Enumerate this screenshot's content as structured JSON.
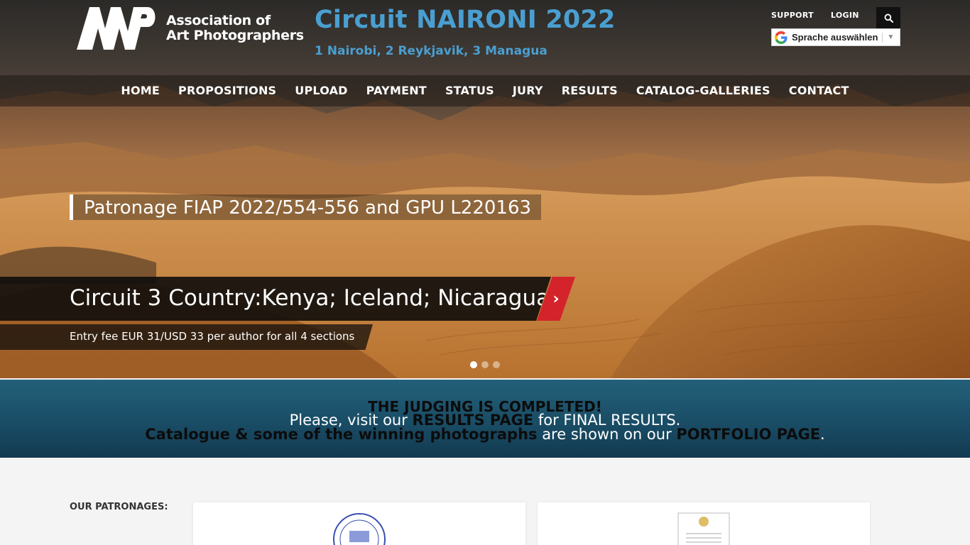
{
  "header": {
    "logo_text_line1": "Association of",
    "logo_text_line2": "Art Photographers",
    "site_title": "Circuit NAIRONI 2022",
    "site_subtitle": "1 Nairobi, 2 Reykjavik, 3 Managua",
    "top_links": [
      "SUPPORT",
      "LOGIN"
    ],
    "translate_label": "Sprache auswählen"
  },
  "nav": {
    "items": [
      "HOME",
      "PROPOSITIONS",
      "UPLOAD",
      "PAYMENT",
      "STATUS",
      "JURY",
      "RESULTS",
      "CATALOG-GALLERIES",
      "CONTACT"
    ]
  },
  "slider": {
    "patronage_caption": "Patronage FIAP 2022/554-556 and GPU L220163",
    "main_caption": "Circuit 3 Country:Kenya; Iceland; Nicaragua",
    "sub_caption": "Entry fee EUR 31/USD 33 per author for all 4 sections",
    "next_glyph": "›",
    "slide_count": 3,
    "active_slide": 1
  },
  "banner": {
    "line1": "THE JUDGING IS COMPLETED!",
    "line2_prefix": "Please, visit our ",
    "line2_link": "RESULTS PAGE",
    "line2_suffix": " for FINAL RESULTS.",
    "line3_link1": "Catalogue & some of the winning photographs",
    "line3_middle": " are shown on our ",
    "line3_link2": "PORTFOLIO PAGE",
    "line3_end": "."
  },
  "patronages": {
    "label": "OUR PATRONAGES:"
  },
  "colors": {
    "title_blue": "#4a9fd1",
    "banner_teal": "#1a4d66",
    "accent_red": "#d4232b"
  }
}
